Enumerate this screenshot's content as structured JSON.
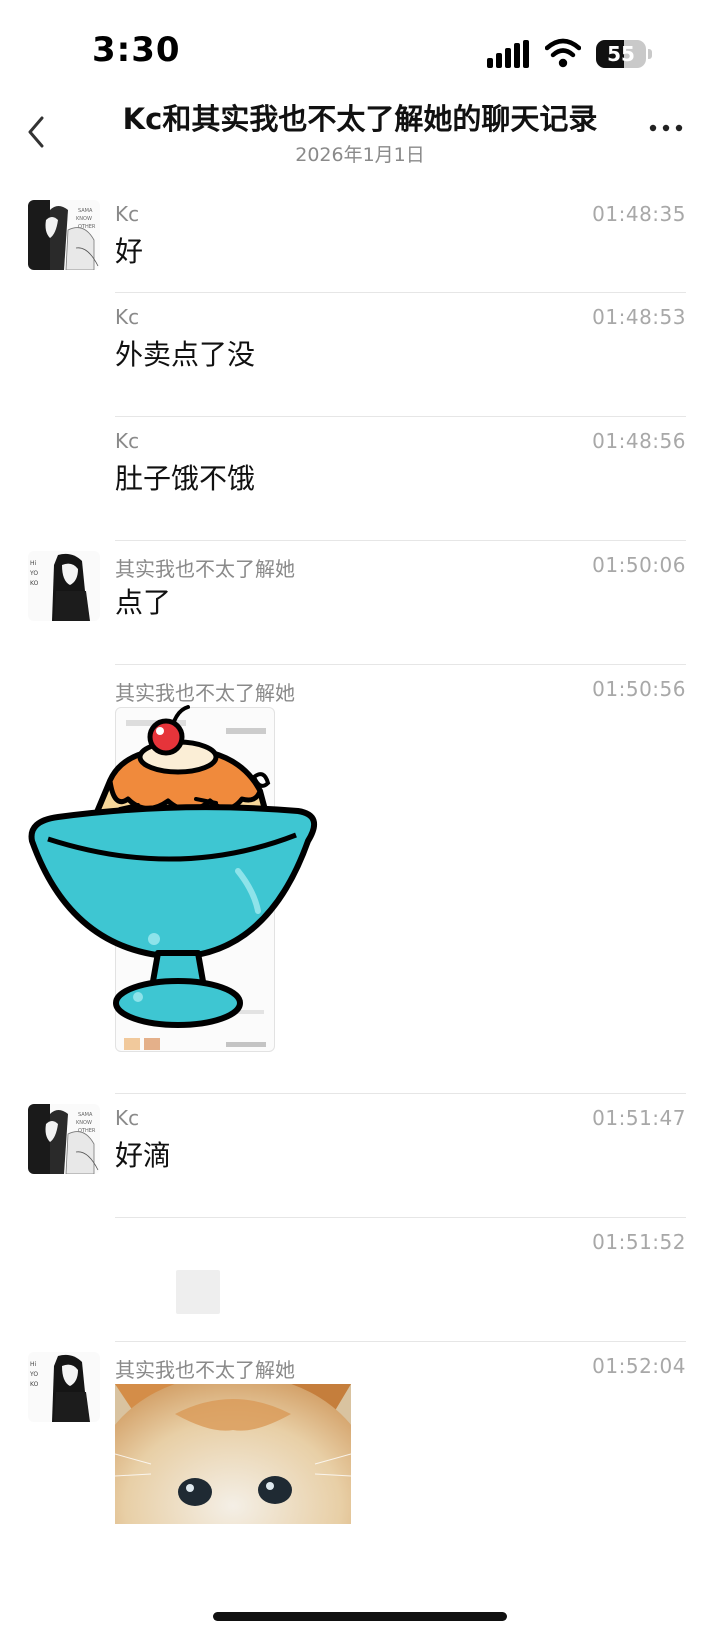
{
  "status_bar": {
    "time": "3:30",
    "battery_level": "55",
    "battery_fraction": 0.55
  },
  "header": {
    "title": "Kc和其实我也不太了解她的聊天记录",
    "subtitle": "2026年1月1日"
  },
  "messages": [
    {
      "sender": "Kc",
      "time": "01:48:35",
      "text": "好",
      "show_avatar": true
    },
    {
      "sender": "Kc",
      "time": "01:48:53",
      "text": "外卖点了没",
      "show_avatar": false
    },
    {
      "sender": "Kc",
      "time": "01:48:56",
      "text": "肚子饿不饿",
      "show_avatar": false
    },
    {
      "sender": "其实我也不太了解她",
      "time": "01:50:06",
      "text": "点了",
      "show_avatar": true
    },
    {
      "sender": "其实我也不太了解她",
      "time": "01:50:56",
      "content": "pudding-sticker-over-screenshot",
      "show_avatar": false
    },
    {
      "sender": "Kc",
      "time": "01:51:47",
      "text": "好滴",
      "show_avatar": true
    },
    {
      "sender": "",
      "time": "01:51:52",
      "content": "image-placeholder",
      "show_avatar": false
    },
    {
      "sender": "其实我也不太了解她",
      "time": "01:52:04",
      "content": "kitten-photo",
      "show_avatar": true
    }
  ],
  "icons": {
    "back": "chevron-left-icon",
    "more": "more-dots-icon",
    "signal": "signal-icon",
    "wifi": "wifi-icon"
  },
  "colors": {
    "timestamp": "#a8a8a8",
    "sender": "#8a8a8a",
    "divider": "#e6e6e6",
    "sticker_bowl": "#3ec6d2",
    "sticker_pudding": "#f7d79a",
    "sticker_caramel": "#f08a3c"
  }
}
